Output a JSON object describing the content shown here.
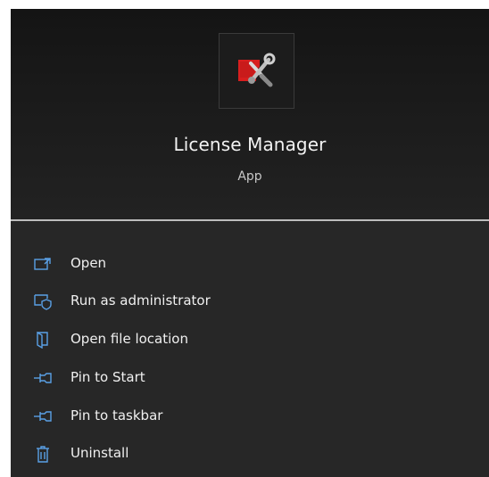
{
  "app": {
    "name": "License Manager",
    "type": "App",
    "icon": "license-manager-app-icon"
  },
  "colors": {
    "panel_background": "#272727",
    "header_background": "#1a1a1a",
    "icon_accent": "#5aa0e6",
    "logo_red": "#d81e1e"
  },
  "menu": {
    "items": [
      {
        "label": "Open",
        "icon": "open-icon"
      },
      {
        "label": "Run as administrator",
        "icon": "run-as-administrator-icon"
      },
      {
        "label": "Open file location",
        "icon": "open-file-location-icon"
      },
      {
        "label": "Pin to Start",
        "icon": "pin-icon"
      },
      {
        "label": "Pin to taskbar",
        "icon": "pin-icon"
      },
      {
        "label": "Uninstall",
        "icon": "uninstall-icon"
      }
    ]
  }
}
